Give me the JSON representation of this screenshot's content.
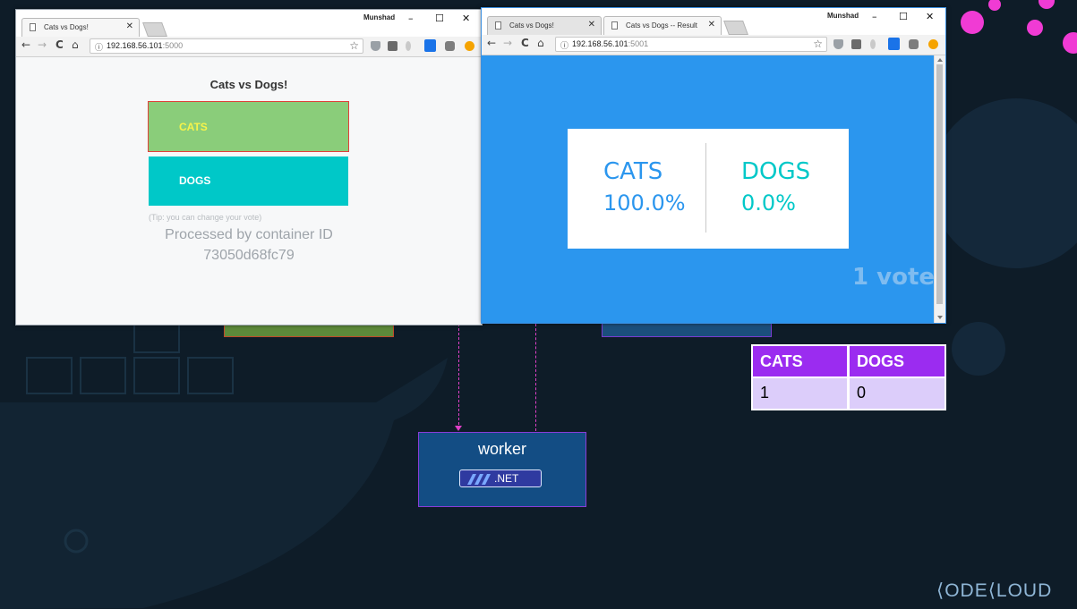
{
  "colors": {
    "background": "#0e1c28",
    "accent_pink": "#f03bd4",
    "cats_green": "#8acd7a",
    "dogs_teal": "#00c8c8",
    "result_blue": "#2b96ee",
    "table_header_purple": "#9b2cf0",
    "table_row_lilac": "#dccdfa",
    "worker_blue": "#134d84"
  },
  "left_window": {
    "tab_title": "Cats vs Dogs!",
    "user_name": "Munshad",
    "url_host": "192.168.56.101",
    "url_port": ":5000",
    "page": {
      "heading": "Cats vs Dogs!",
      "cats_label": "CATS",
      "dogs_label": "DOGS",
      "tip": "(Tip: you can change your vote)",
      "processed_by": "Processed by container ID",
      "container_id": "73050d68fc79"
    }
  },
  "right_window": {
    "tab1_title": "Cats vs Dogs!",
    "tab2_title": "Cats vs Dogs -- Result",
    "user_name": "Munshad",
    "url_host": "192.168.56.101",
    "url_port": ":5001",
    "result": {
      "cats_label": "CATS",
      "cats_percent": "100.0%",
      "dogs_label": "DOGS",
      "dogs_percent": "0.0%",
      "vote_count": "1 vote"
    }
  },
  "db_table": {
    "headers": [
      "CATS",
      "DOGS"
    ],
    "row": [
      "1",
      "0"
    ]
  },
  "worker": {
    "label": "worker",
    "badge": ".NET"
  },
  "brand": {
    "logo_text": "KODEKLOUD"
  },
  "icons": {
    "back": "←",
    "forward": "→",
    "reload": "C",
    "home": "⌂",
    "info": "ⓘ",
    "star": "☆",
    "minimize": "–",
    "maximize": "☐",
    "close": "✕"
  }
}
